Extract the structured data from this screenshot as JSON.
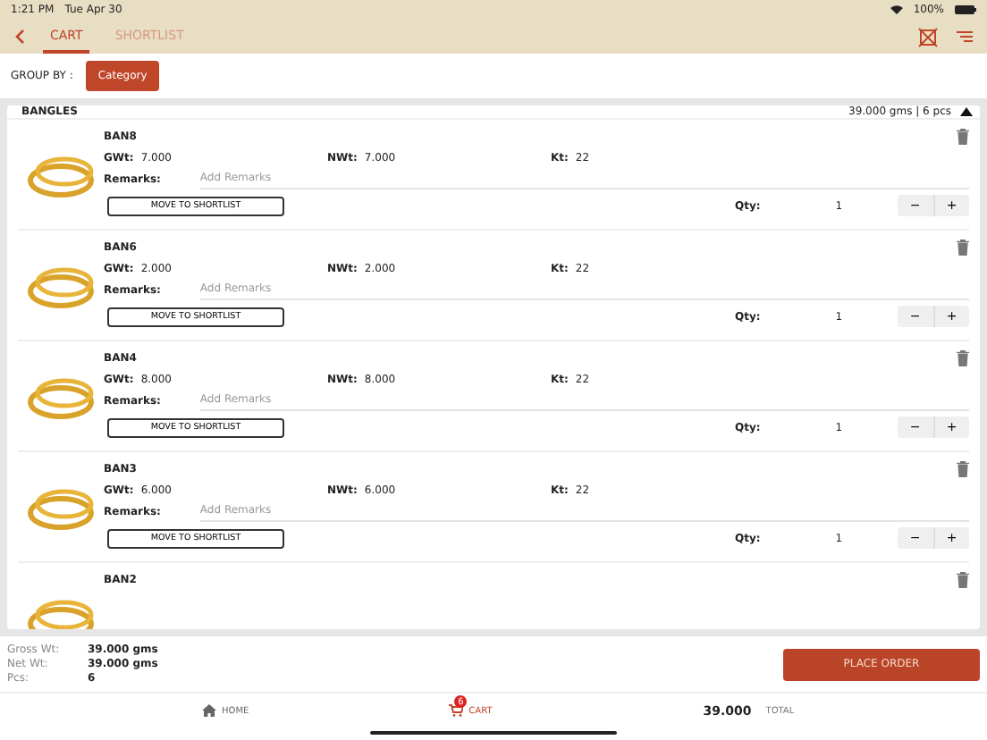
{
  "status_bar": {
    "time": "1:21 PM",
    "date": "Tue Apr 30",
    "battery": "100%"
  },
  "tabs": [
    {
      "label": "CART",
      "selected": true
    },
    {
      "label": "SHORTLIST",
      "selected": false
    }
  ],
  "group_by": {
    "label": "GROUP BY :",
    "value": "Category"
  },
  "group": {
    "title": "BANGLES",
    "summary": "39.000 gms | 6 pcs",
    "expanded": true,
    "items": [
      {
        "name": "BAN8",
        "gwt_label": "GWt:",
        "gwt": "7.000",
        "nwt_label": "NWt:",
        "nwt": "7.000",
        "kt_label": "Kt:",
        "kt": "22",
        "remarks_label": "Remarks:",
        "remarks_placeholder": "Add Remarks",
        "button": "MOVE TO SHORTLIST",
        "qty_label": "Qty:",
        "qty": "1",
        "stepper": [
          "−",
          "+"
        ]
      },
      {
        "name": "BAN6",
        "gwt_label": "GWt:",
        "gwt": "2.000",
        "nwt_label": "NWt:",
        "nwt": "2.000",
        "kt_label": "Kt:",
        "kt": "22",
        "remarks_label": "Remarks:",
        "remarks_placeholder": "Add Remarks",
        "button": "MOVE TO SHORTLIST",
        "qty_label": "Qty:",
        "qty": "1",
        "stepper": [
          "−",
          "+"
        ]
      },
      {
        "name": "BAN4",
        "gwt_label": "GWt:",
        "gwt": "8.000",
        "nwt_label": "NWt:",
        "nwt": "8.000",
        "kt_label": "Kt:",
        "kt": "22",
        "remarks_label": "Remarks:",
        "remarks_placeholder": "Add Remarks",
        "button": "MOVE TO SHORTLIST",
        "qty_label": "Qty:",
        "qty": "1",
        "stepper": [
          "−",
          "+"
        ]
      },
      {
        "name": "BAN3",
        "gwt_label": "GWt:",
        "gwt": "6.000",
        "nwt_label": "NWt:",
        "nwt": "6.000",
        "kt_label": "Kt:",
        "kt": "22",
        "remarks_label": "Remarks:",
        "remarks_placeholder": "Add Remarks",
        "button": "MOVE TO SHORTLIST",
        "qty_label": "Qty:",
        "qty": "1",
        "stepper": [
          "−",
          "+"
        ]
      },
      {
        "name": "BAN2"
      }
    ]
  },
  "summary": [
    {
      "label": "Gross Wt:",
      "value": "39.000 gms"
    },
    {
      "label": "Net Wt:",
      "value": "39.000 gms"
    },
    {
      "label": "Pcs:",
      "value": "6"
    }
  ],
  "place_order": "PLACE ORDER",
  "bottom_nav": {
    "home": "HOME",
    "cart": "CART",
    "cart_badge": "6",
    "total_value": "39.000",
    "total_label": "TOTAL"
  }
}
